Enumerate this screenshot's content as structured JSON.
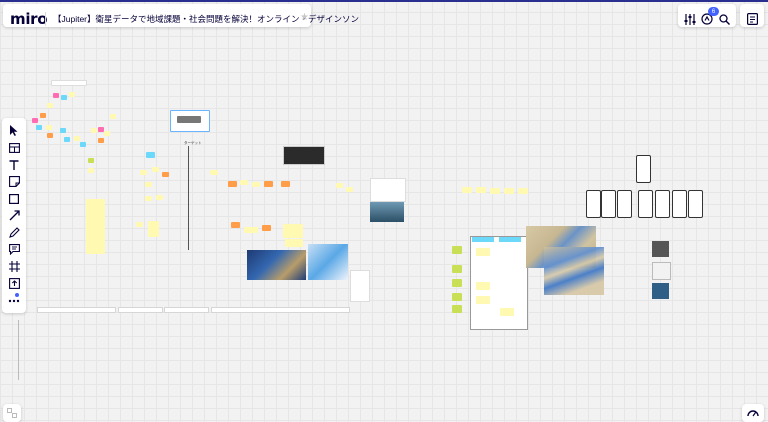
{
  "app": {
    "logo": "miro",
    "board_title": "【Jupiter】衛星データで地域課題・社会問題を解決！オンライン・デザインソン",
    "star_icon": "star-icon"
  },
  "toolbar_right": {
    "collaborators_badge": "6"
  },
  "colors": {
    "accent": "#4262ff",
    "brand_bar": "#2a2f8f",
    "sticky_yellow": "#fff9b1",
    "sticky_orange": "#ff9d48",
    "sticky_blue": "#6cd8fa",
    "sticky_pink": "#ff6cb2",
    "sticky_green": "#c9df56"
  },
  "left_tools": [
    {
      "name": "select-tool",
      "icon": "cursor-icon"
    },
    {
      "name": "templates-tool",
      "icon": "templates-icon"
    },
    {
      "name": "text-tool",
      "icon": "text-icon"
    },
    {
      "name": "sticky-note-tool",
      "icon": "sticky-note-icon"
    },
    {
      "name": "shape-tool",
      "icon": "square-icon"
    },
    {
      "name": "connection-line-tool",
      "icon": "arrow-icon"
    },
    {
      "name": "pen-tool",
      "icon": "pen-icon"
    },
    {
      "name": "comment-tool",
      "icon": "comment-icon"
    },
    {
      "name": "frame-tool",
      "icon": "frame-icon"
    },
    {
      "name": "upload-tool",
      "icon": "upload-icon"
    },
    {
      "name": "more-tools",
      "icon": "more-icon"
    }
  ],
  "canvas": {
    "center_label": "ターゲット"
  }
}
